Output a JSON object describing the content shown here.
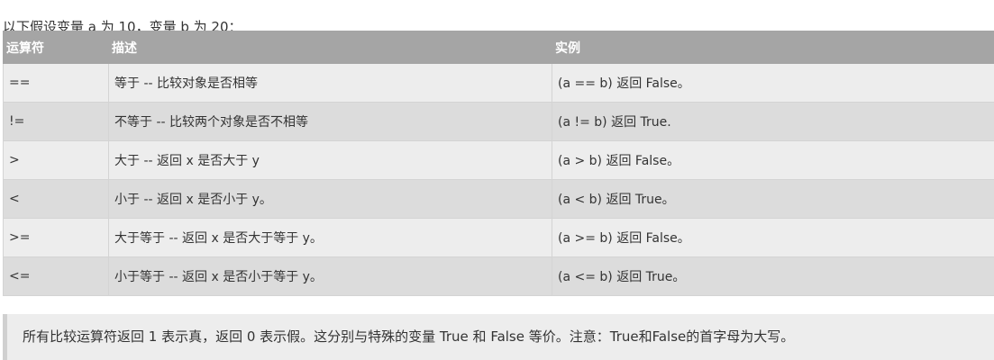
{
  "intro": "以下假设变量 a 为 10，变量 b 为 20：",
  "table": {
    "headers": [
      "运算符",
      "描述",
      "实例"
    ],
    "rows": [
      [
        "==",
        "等于 -- 比较对象是否相等",
        "(a == b) 返回 False。"
      ],
      [
        "!=",
        "不等于 -- 比较两个对象是否不相等",
        "(a != b) 返回 True."
      ],
      [
        ">",
        "大于 -- 返回 x 是否大于 y",
        "(a > b) 返回 False。"
      ],
      [
        "<",
        "小于 -- 返回 x 是否小于 y。",
        "(a < b) 返回 True。"
      ],
      [
        ">=",
        "大于等于 -- 返回 x 是否大于等于 y。",
        "(a >= b) 返回 False。"
      ],
      [
        "<=",
        "小于等于 -- 返回 x 是否小于等于 y。",
        "(a <= b) 返回 True。"
      ]
    ]
  },
  "note": "所有比较运算符返回 1 表示真，返回 0 表示假。这分别与特殊的变量 True 和 False 等价。注意：True和False的首字母为大写。"
}
